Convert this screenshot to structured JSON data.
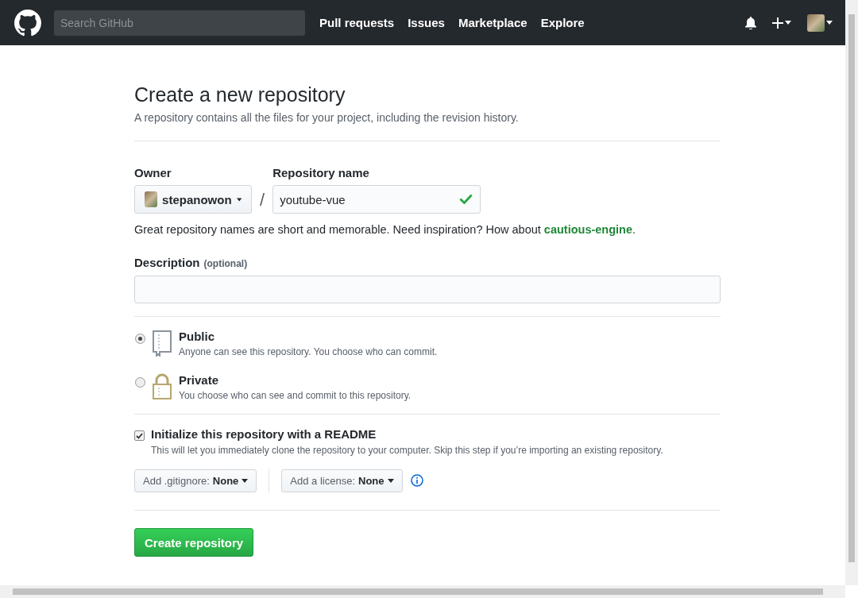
{
  "header": {
    "search": {
      "placeholder": "Search GitHub"
    },
    "nav": [
      "Pull requests",
      "Issues",
      "Marketplace",
      "Explore"
    ]
  },
  "title": "Create a new repository",
  "subtitle": "A repository contains all the files for your project, including the revision history.",
  "owner": {
    "label": "Owner",
    "value": "stepanowon"
  },
  "separator": "/",
  "repo_name": {
    "label": "Repository name",
    "value": "youtube-vue",
    "valid": true
  },
  "hint": {
    "text": "Great repository names are short and memorable. Need inspiration? How about ",
    "suggestion": "cautious-engine",
    "end": "."
  },
  "description": {
    "label": "Description",
    "optional": "(optional)"
  },
  "visibility": [
    {
      "kind": "public",
      "title": "Public",
      "text": "Anyone can see this repository. You choose who can commit.",
      "selected": true
    },
    {
      "kind": "private",
      "title": "Private",
      "text": "You choose who can see and commit to this repository.",
      "selected": false
    }
  ],
  "readme": {
    "label": "Initialize this repository with a README",
    "text": "This will let you immediately clone the repository to your computer. Skip this step if you’re importing an existing repository.",
    "checked": true
  },
  "dropdowns": [
    {
      "label": "Add .gitignore:",
      "value": "None"
    },
    {
      "label": "Add a license:",
      "value": "None"
    }
  ],
  "submit": "Create repository"
}
